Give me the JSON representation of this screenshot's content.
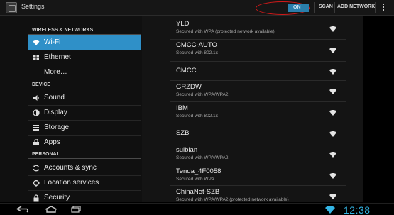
{
  "actionbar": {
    "title": "Settings",
    "wifi_toggle_label": "ON",
    "scan_label": "SCAN",
    "add_network_label": "ADD NETWORK"
  },
  "sidebar": {
    "sections": [
      {
        "label": "WIRELESS & NETWORKS"
      },
      {
        "label": "DEVICE"
      },
      {
        "label": "PERSONAL"
      }
    ],
    "items": [
      {
        "label": "Wi-Fi",
        "selected": true,
        "icon": "wifi-icon"
      },
      {
        "label": "Ethernet",
        "icon": "ethernet-icon"
      },
      {
        "label": "More…",
        "icon": ""
      },
      {
        "label": "Sound",
        "icon": "speaker-icon"
      },
      {
        "label": "Display",
        "icon": "display-icon"
      },
      {
        "label": "Storage",
        "icon": "storage-icon"
      },
      {
        "label": "Apps",
        "icon": "apps-icon"
      },
      {
        "label": "Accounts & sync",
        "icon": "sync-icon"
      },
      {
        "label": "Location services",
        "icon": "location-icon"
      },
      {
        "label": "Security",
        "icon": "lock-icon"
      }
    ]
  },
  "networks": [
    {
      "name": "YLD",
      "security": "Secured with WPA (protected network available)"
    },
    {
      "name": "CMCC-AUTO",
      "security": "Secured with 802.1x"
    },
    {
      "name": "CMCC",
      "security": ""
    },
    {
      "name": "GRZDW",
      "security": "Secured with WPA/WPA2"
    },
    {
      "name": "IBM",
      "security": "Secured with 802.1x"
    },
    {
      "name": "SZB",
      "security": ""
    },
    {
      "name": "suibian",
      "security": "Secured with WPA/WPA2"
    },
    {
      "name": "Tenda_4F0058",
      "security": "Secured with WPA"
    },
    {
      "name": "ChinaNet-SZB",
      "security": "Secured with WPA/WPA2 (protected network available)"
    }
  ],
  "navbar": {
    "time": "12:38"
  },
  "colors": {
    "accent": "#33b5e5",
    "selected": "#2f90c8",
    "annotation": "#d41a1a"
  }
}
